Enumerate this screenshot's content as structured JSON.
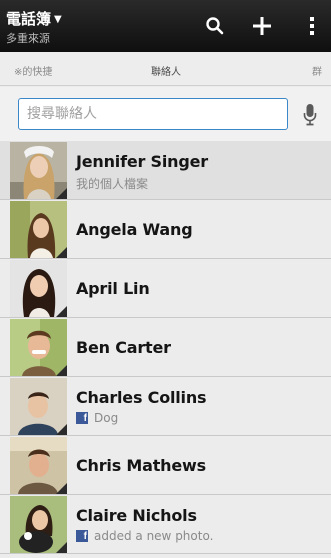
{
  "header": {
    "title": "電話簿",
    "subtitle": "多重來源",
    "icons": [
      "search-icon",
      "add-icon",
      "overflow-menu-icon"
    ]
  },
  "tabs": {
    "left": "※的快捷",
    "center": "聯絡人",
    "right": "群"
  },
  "search": {
    "placeholder": "搜尋聯絡人"
  },
  "contacts": [
    {
      "name": "Jennifer Singer",
      "detail": "我的個人檔案",
      "source": ""
    },
    {
      "name": "Angela Wang",
      "detail": "",
      "source": ""
    },
    {
      "name": "April Lin",
      "detail": "",
      "source": ""
    },
    {
      "name": "Ben Carter",
      "detail": "",
      "source": ""
    },
    {
      "name": "Charles Collins",
      "detail": "Dog",
      "source": "facebook"
    },
    {
      "name": "Chris Mathews",
      "detail": "",
      "source": ""
    },
    {
      "name": "Claire Nichols",
      "detail": "added a new photo.",
      "source": "facebook"
    }
  ],
  "colors": {
    "topbar": "#1a1a1a",
    "accent": "#3b87c8",
    "facebook": "#3b5998"
  }
}
